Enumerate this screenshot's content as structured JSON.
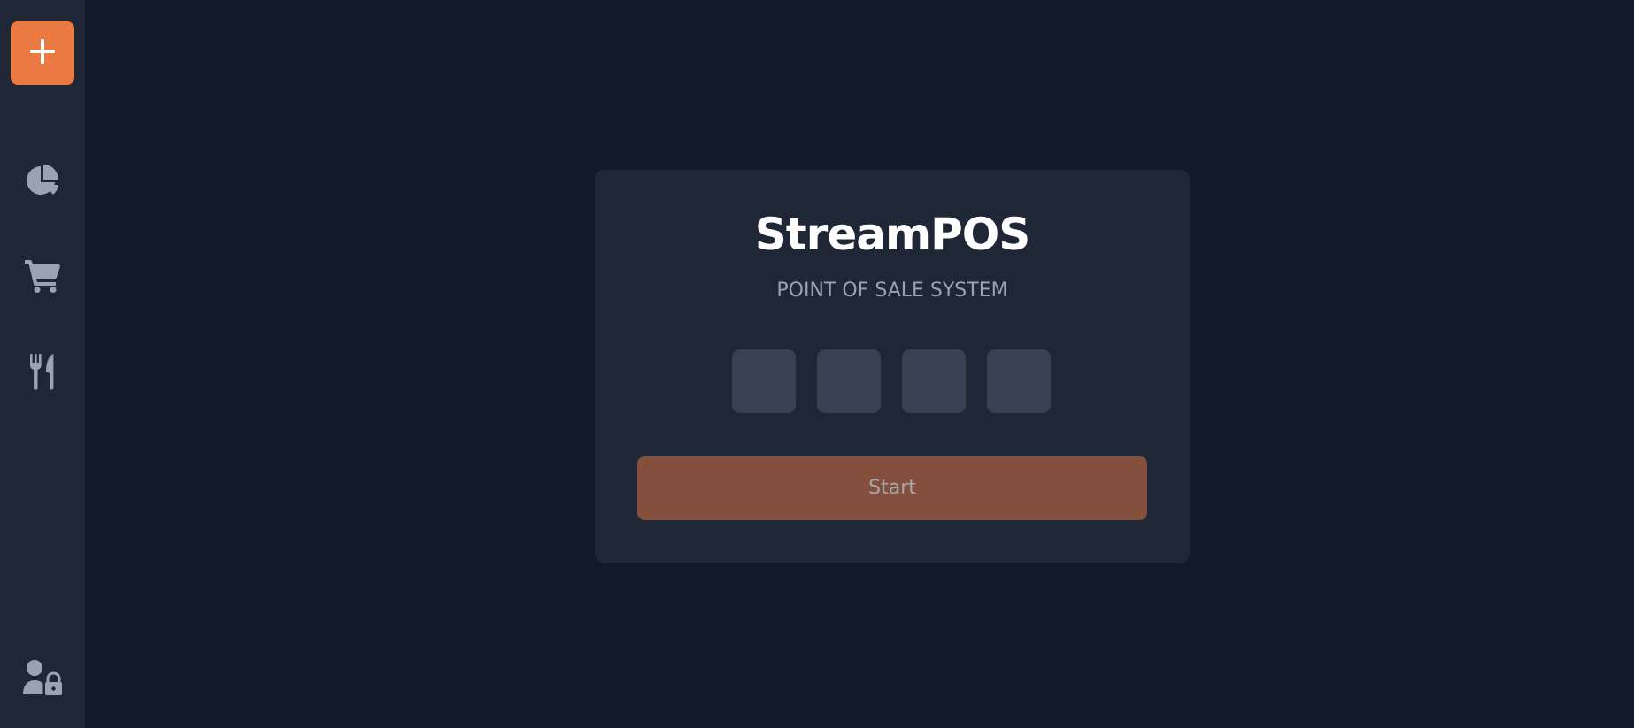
{
  "app": {
    "title": "StreamPOS",
    "subtitle": "POINT OF SALE SYSTEM"
  },
  "sidebar": {
    "new_button": {
      "icon": "plus-icon"
    },
    "items": [
      {
        "id": "reports",
        "icon": "pie-chart-icon"
      },
      {
        "id": "orders",
        "icon": "shopping-cart-icon"
      },
      {
        "id": "menu",
        "icon": "utensils-icon"
      }
    ],
    "footer_item": {
      "id": "user-lock",
      "icon": "user-lock-icon"
    }
  },
  "login": {
    "pin": [
      "",
      "",
      "",
      ""
    ],
    "start_label": "Start"
  },
  "colors": {
    "background": "#121929",
    "sidebar": "#1f2736",
    "card": "#1f2736",
    "accent": "#ea7a42",
    "start_button_disabled": "#84503d",
    "pin_box": "#384152",
    "icon": "#9aa3b2"
  }
}
